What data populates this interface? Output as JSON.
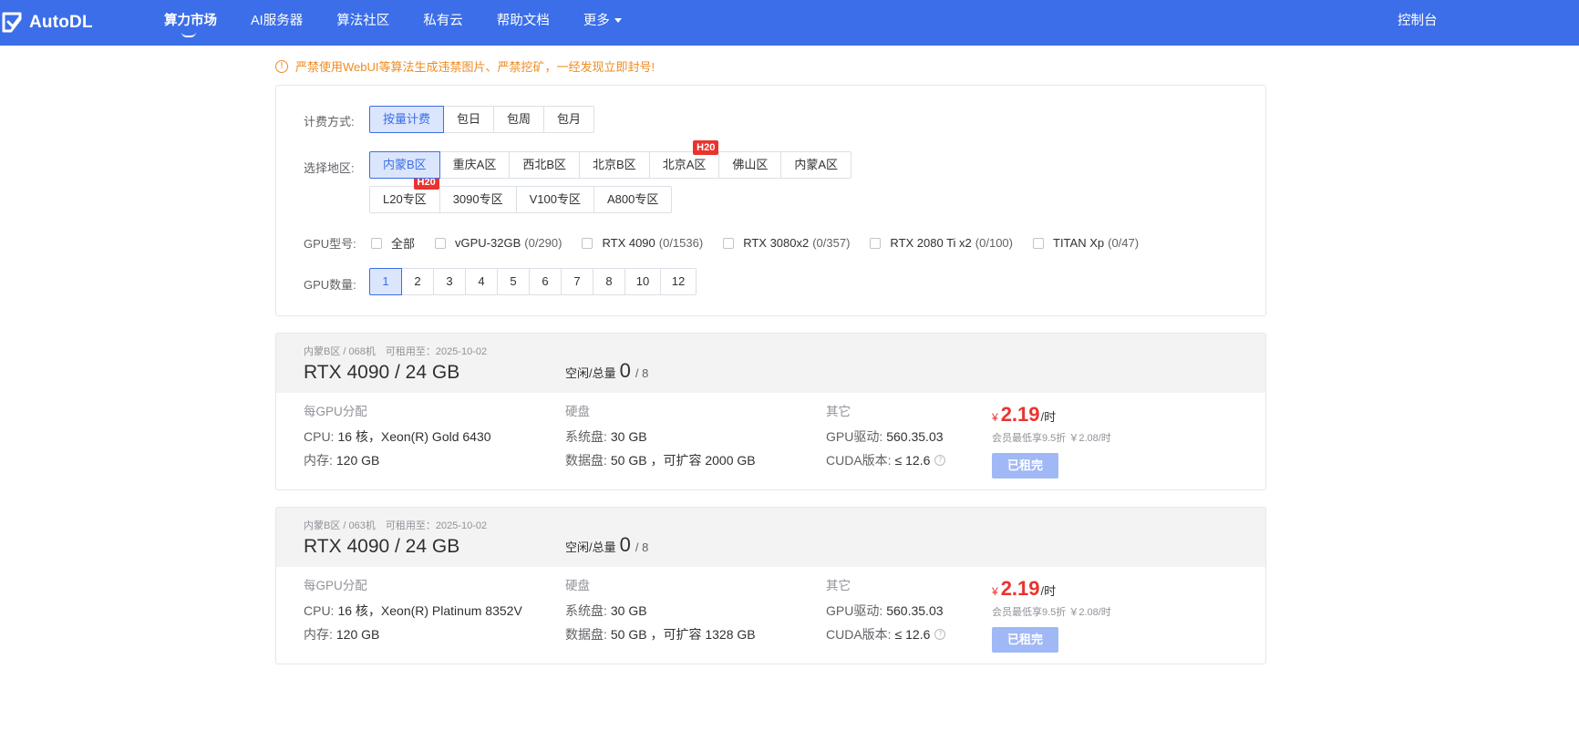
{
  "brand": {
    "name": "AutoDL"
  },
  "nav": {
    "items": [
      "算力市场",
      "AI服务器",
      "算法社区",
      "私有云",
      "帮助文档",
      "更多"
    ],
    "console": "控制台"
  },
  "warning": {
    "text": "严禁使用WebUI等算法生成违禁图片、严禁挖矿，一经发现立即封号!"
  },
  "filters": {
    "billing": {
      "label": "计费方式:",
      "options": [
        "按量计费",
        "包日",
        "包周",
        "包月"
      ],
      "selected": "按量计费"
    },
    "region": {
      "label": "选择地区:",
      "row1": [
        "内蒙B区",
        "重庆A区",
        "西北B区",
        "北京B区",
        "北京A区",
        "佛山区",
        "内蒙A区"
      ],
      "row2": [
        "L20专区",
        "3090专区",
        "V100专区",
        "A800专区"
      ],
      "selected": "内蒙B区",
      "badges": {
        "beijing_a": "H20",
        "l20": "H20"
      }
    },
    "gpu_type": {
      "label": "GPU型号:",
      "options": [
        {
          "name": "全部",
          "count": ""
        },
        {
          "name": "vGPU-32GB",
          "count": "(0/290)"
        },
        {
          "name": "RTX 4090",
          "count": "(0/1536)"
        },
        {
          "name": "RTX 3080x2",
          "count": "(0/357)"
        },
        {
          "name": "RTX 2080 Ti x2",
          "count": "(0/100)"
        },
        {
          "name": "TITAN Xp",
          "count": "(0/47)"
        }
      ]
    },
    "gpu_count": {
      "label": "GPU数量:",
      "options": [
        "1",
        "2",
        "3",
        "4",
        "5",
        "6",
        "7",
        "8",
        "10",
        "12"
      ],
      "selected": "1"
    }
  },
  "cards": [
    {
      "meta": "内蒙B区 / 068机　可租用至：2025-10-02",
      "title": "RTX 4090 / 24 GB",
      "avail_label": "空闲/总量",
      "free": "0",
      "total": "/ 8",
      "per_gpu": {
        "head": "每GPU分配",
        "cpu_k": "CPU:",
        "cpu_v": "16 核，Xeon(R) Gold 6430",
        "mem_k": "内存:",
        "mem_v": "120 GB"
      },
      "disk": {
        "head": "硬盘",
        "sys_k": "系统盘:",
        "sys_v": "30 GB",
        "data_k": "数据盘:",
        "data_v": "50 GB ，可扩容 2000 GB"
      },
      "other": {
        "head": "其它",
        "driver_k": "GPU驱动:",
        "driver_v": "560.35.03",
        "cuda_k": "CUDA版本:",
        "cuda_v": "≤ 12.6"
      },
      "price": {
        "yen": "¥",
        "num": "2.19",
        "unit": "/时",
        "discount": "会员最低享9.5折 ￥2.08/时",
        "button": "已租完"
      }
    },
    {
      "meta": "内蒙B区 / 063机　可租用至：2025-10-02",
      "title": "RTX 4090 / 24 GB",
      "avail_label": "空闲/总量",
      "free": "0",
      "total": "/ 8",
      "per_gpu": {
        "head": "每GPU分配",
        "cpu_k": "CPU:",
        "cpu_v": "16 核，Xeon(R) Platinum 8352V",
        "mem_k": "内存:",
        "mem_v": "120 GB"
      },
      "disk": {
        "head": "硬盘",
        "sys_k": "系统盘:",
        "sys_v": "30 GB",
        "data_k": "数据盘:",
        "data_v": "50 GB ，可扩容 1328 GB"
      },
      "other": {
        "head": "其它",
        "driver_k": "GPU驱动:",
        "driver_v": "560.35.03",
        "cuda_k": "CUDA版本:",
        "cuda_v": "≤ 12.6"
      },
      "price": {
        "yen": "¥",
        "num": "2.19",
        "unit": "/时",
        "discount": "会员最低享9.5折 ￥2.08/时",
        "button": "已租完"
      }
    }
  ],
  "colors": {
    "brand": "#3b6ee8",
    "price": "#e9342e",
    "warning": "#f08b1e",
    "badge": "#e9342e"
  }
}
